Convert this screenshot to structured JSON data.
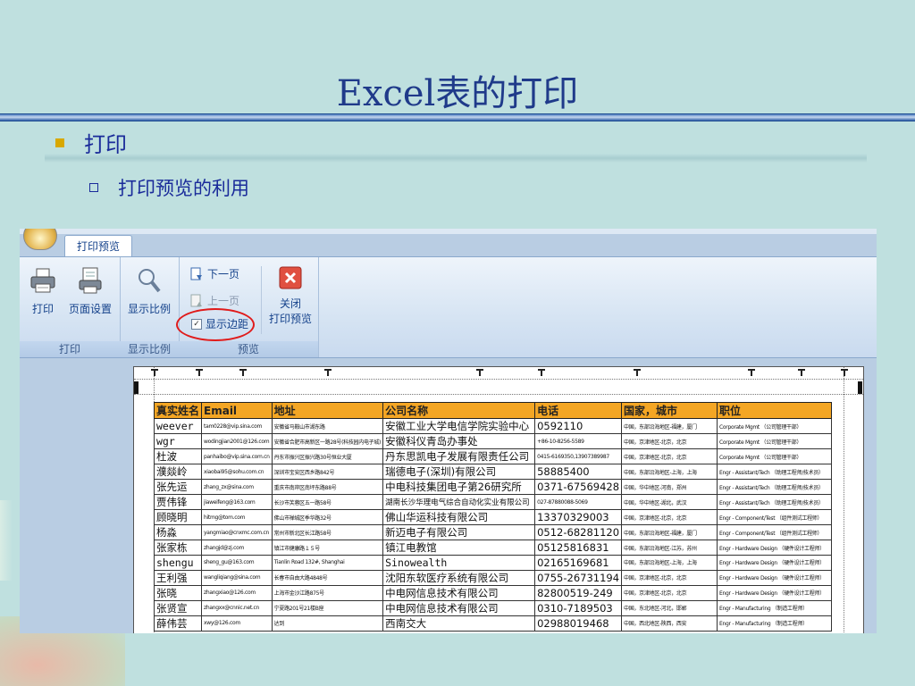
{
  "slide": {
    "title": "Excel表的打印",
    "bullet1": "打印",
    "bullet2": "打印预览的利用"
  },
  "ribbon": {
    "tab_label": "打印预览",
    "groups": {
      "print": "打印",
      "zoom": "显示比例",
      "preview": "预览"
    },
    "print_button": "打印",
    "page_setup_button": "页面设置",
    "zoom_button": "显示比例",
    "next_page": "下一页",
    "prev_page": "上一页",
    "show_margins": "显示边距",
    "close_label_1": "关闭",
    "close_label_2": "打印预览"
  },
  "sheet": {
    "headers": [
      "真实姓名",
      "Email",
      "地址",
      "公司名称",
      "电话",
      "国家，城市",
      "职位"
    ],
    "rows": [
      [
        "weever",
        "tam0228@vip.sina.com",
        "安徽省马鞍山市湖东路",
        "安徽工业大学电信学院实验中心",
        "0592110",
        "中国，东部沿海地区-福建，厦门",
        "Corporate Mgmt （公司管理干部）"
      ],
      [
        "wgr",
        "wodingjian2001@126.com",
        "安徽省合肥市高新区一路28号(科技园内电子城)",
        "安徽科仪青岛办事处",
        "+86-10-8256-5589",
        "中国，京津地区-北京，北京",
        "Corporate Mgmt （公司管理干部）"
      ],
      [
        "杜波",
        "panhaibo@vip.sina.com.cn",
        "丹东市振兴区振兴路30号恒业大厦",
        "丹东思凯电子发展有限责任公司",
        "0415-6169350,13907389987",
        "中国，京津地区-北京，北京",
        "Corporate Mgmt （公司管理干部）"
      ],
      [
        "濮燚岭",
        "xiaobai95@sohu.com.cn",
        "深圳市宝安区西乡路842号",
        "瑞德电子(深圳)有限公司",
        "58885400",
        "中国，东部沿海地区-上海，上海",
        "Engr - Assistant/Tech （助理工程师/技术员）"
      ],
      [
        "张先运",
        "zhang_zx@sina.com",
        "重庆市南岸区南坪东路88号",
        "中电科技集团电子第26研究所",
        "0371-67569428",
        "中国，华中地区-河南，郑州",
        "Engr - Assistant/Tech （助理工程师/技术员）"
      ],
      [
        "贾伟锋",
        "jiaweifeng@163.com",
        "长沙市芙蓉区五一路58号",
        "湖南长沙华理电气综合自动化实业有限公司",
        "027-87880088-5069",
        "中国，华中地区-湖北，武汉",
        "Engr - Assistant/Tech （助理工程师/技术员）"
      ],
      [
        "顾晓明",
        "hitmg@tom.com",
        "佛山市禅城区季华路32号",
        "佛山华运科技有限公司",
        "13370329003",
        "中国，京津地区-北京，北京",
        "Engr - Component/Test （组件测试工程师）"
      ],
      [
        "杨淼",
        "yangmiao@cnxmc.com.cn",
        "常州市新北区长江路58号",
        "新迈电子有限公司",
        "0512-68281120",
        "中国，东部沿海地区-福建，厦门",
        "Engr - Component/Test （组件测试工程师）"
      ],
      [
        "张家栋",
        "zhangjd@zj.com",
        "镇江市健康路１５号",
        "镇江电教馆",
        "05125816831",
        "中国，东部沿海地区-江苏，苏州",
        "Engr - Hardware Design （硬件设计工程师）"
      ],
      [
        "shengu",
        "sheng_gu@163.com",
        "Tianlin Road 132#, Shanghai",
        "Sinowealth",
        "02165169681",
        "中国，东部沿海地区-上海，上海",
        "Engr - Hardware Design （硬件设计工程师）"
      ],
      [
        "王利强",
        "wangliqiang@sina.com",
        "长春市自由大路4848号",
        "沈阳东软医疗系统有限公司",
        "0755-26731194",
        "中国，京津地区-北京，北京",
        "Engr - Hardware Design （硬件设计工程师）"
      ],
      [
        "张晓",
        "zhangxiao@126.com",
        "上海市金沙江路875号",
        "中电网信息技术有限公司",
        "82800519-249",
        "中国，京津地区-北京，北京",
        "Engr - Hardware Design （硬件设计工程师）"
      ],
      [
        "张贤宣",
        "zhangxx@cnnic.net.cn",
        "宁夏路201号21楼B座",
        "中电网信息技术有限公司",
        "0310-7189503",
        "中国，东北地区-河北，邯郸",
        "Engr - Manufacturing （制造工程师）"
      ],
      [
        "薛伟芸",
        "xwy@126.com",
        "达到",
        "西南交大",
        "02988019468",
        "中国，西北地区-陕西，西安",
        "Engr - Manufacturing （制造工程师）"
      ]
    ]
  }
}
